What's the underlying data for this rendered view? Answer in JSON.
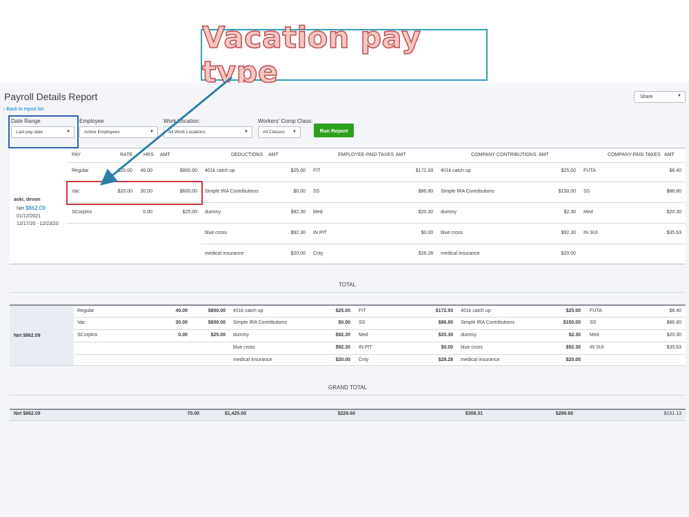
{
  "callout": {
    "text": "Vacation pay type"
  },
  "report": {
    "title": "Payroll Details Report",
    "back_link": "Back to report list",
    "share_label": "Share"
  },
  "filters": {
    "date_range": {
      "label": "Date Range",
      "value": "Last pay date"
    },
    "employee": {
      "label": "Employee",
      "value": "Active Employees"
    },
    "work_location": {
      "label": "Work Location:",
      "value": "All Work Locations"
    },
    "workers_comp": {
      "label": "Workers' Comp Class:",
      "value": "All Classes"
    },
    "run_report_label": "Run Report"
  },
  "columns": {
    "pay": "PAY",
    "rate": "RATE",
    "hrs": "HRS",
    "amt": "AMT",
    "deductions": "DEDUCTIONS",
    "employee_paid_taxes": "EMPLOYEE-PAID TAXES",
    "company_contributions": "COMPANY CONTRIBUTIONS",
    "company_paid_taxes": "COMPANY-PAID TAXES"
  },
  "employee": {
    "name": "aoki, devon",
    "net_label": "Net",
    "net": "$862.09",
    "pay_date": "01/12/2021",
    "period": "12/17/20 -  12/23/20"
  },
  "detail_rows": [
    {
      "pay": "Regular",
      "rate": "$20.00",
      "hrs": "40.00",
      "amt": "$800.00",
      "ded": "401k catch up",
      "ded_amt": "$25.00",
      "tax": "FIT",
      "tax_amt": "$172.93",
      "cc": "401k catch up",
      "cc_amt": "$25.00",
      "ctax": "FUTA",
      "ctax_amt": "$8.40"
    },
    {
      "pay": "Vac",
      "rate": "$20.00",
      "hrs": "30.00",
      "amt": "$600.00",
      "ded": "Simple IRA Contributions",
      "ded_amt": "$0.00",
      "tax": "SS",
      "tax_amt": "$86.80",
      "cc": "Simple IRA Contributions",
      "cc_amt": "$150.00",
      "ctax": "SS",
      "ctax_amt": "$86.80"
    },
    {
      "pay": "SCorpIns",
      "rate": "",
      "hrs": "0.00",
      "amt": "$25.00",
      "ded": "dummy",
      "ded_amt": "$92.30",
      "tax": "Med",
      "tax_amt": "$20.30",
      "cc": "dummy",
      "cc_amt": "$2.30",
      "ctax": "Med",
      "ctax_amt": "$20.30"
    },
    {
      "pay": "",
      "rate": "",
      "hrs": "",
      "amt": "",
      "ded": "blue cross",
      "ded_amt": "$92.30",
      "tax": "IN PIT",
      "tax_amt": "$0.00",
      "cc": "blue cross",
      "cc_amt": "$92.30",
      "ctax": "IN SUI",
      "ctax_amt": "$35.63"
    },
    {
      "pay": "",
      "rate": "",
      "hrs": "",
      "amt": "",
      "ded": "medical insurance",
      "ded_amt": "$20.00",
      "tax": "Cnty",
      "tax_amt": "$28.28",
      "cc": "medical insurance",
      "cc_amt": "$20.00",
      "ctax": "",
      "ctax_amt": ""
    }
  ],
  "total": {
    "title": "TOTAL",
    "net_label": "Net $862.09",
    "rows": [
      {
        "pay": "Regular",
        "hrs": "40.00",
        "amt": "$800.00",
        "ded": "401k catch up",
        "ded_amt": "$25.00",
        "tax": "FIT",
        "tax_amt": "$172.93",
        "cc": "401k catch up",
        "cc_amt": "$25.00",
        "ctax": "FUTA",
        "ctax_amt": "$8.40"
      },
      {
        "pay": "Vac",
        "hrs": "30.00",
        "amt": "$600.00",
        "ded": "Simple IRA Contributions",
        "ded_amt": "$0.00",
        "tax": "SS",
        "tax_amt": "$86.80",
        "cc": "Simple IRA Contributions",
        "cc_amt": "$150.00",
        "ctax": "SS",
        "ctax_amt": "$86.80"
      },
      {
        "pay": "SCorpIns",
        "hrs": "0.00",
        "amt": "$25.00",
        "ded": "dummy",
        "ded_amt": "$92.30",
        "tax": "Med",
        "tax_amt": "$20.30",
        "cc": "dummy",
        "cc_amt": "$2.30",
        "ctax": "Med",
        "ctax_amt": "$20.30"
      },
      {
        "pay": "",
        "hrs": "",
        "amt": "",
        "ded": "blue cross",
        "ded_amt": "$92.30",
        "tax": "IN PIT",
        "tax_amt": "$0.00",
        "cc": "blue cross",
        "cc_amt": "$92.30",
        "ctax": "IN SUI",
        "ctax_amt": "$35.63"
      },
      {
        "pay": "",
        "hrs": "",
        "amt": "",
        "ded": "medical insurance",
        "ded_amt": "$20.00",
        "tax": "Cnty",
        "tax_amt": "$28.28",
        "cc": "medical insurance",
        "cc_amt": "$20.00",
        "ctax": "",
        "ctax_amt": ""
      }
    ]
  },
  "grand_total": {
    "title": "GRAND TOTAL",
    "net_label": "Net $862.09",
    "hrs": "70.00",
    "amt": "$1,425.00",
    "ded_amt": "$229.60",
    "tax_amt": "$308.31",
    "cc_amt": "$289.60",
    "ctax_amt": "$151.13"
  },
  "colors": {
    "accent_green": "#2ca01c",
    "link_blue": "#0077c5",
    "highlight_red": "#d0343b",
    "highlight_blue": "#2a63b0",
    "callout_border": "#2e9fbd"
  }
}
